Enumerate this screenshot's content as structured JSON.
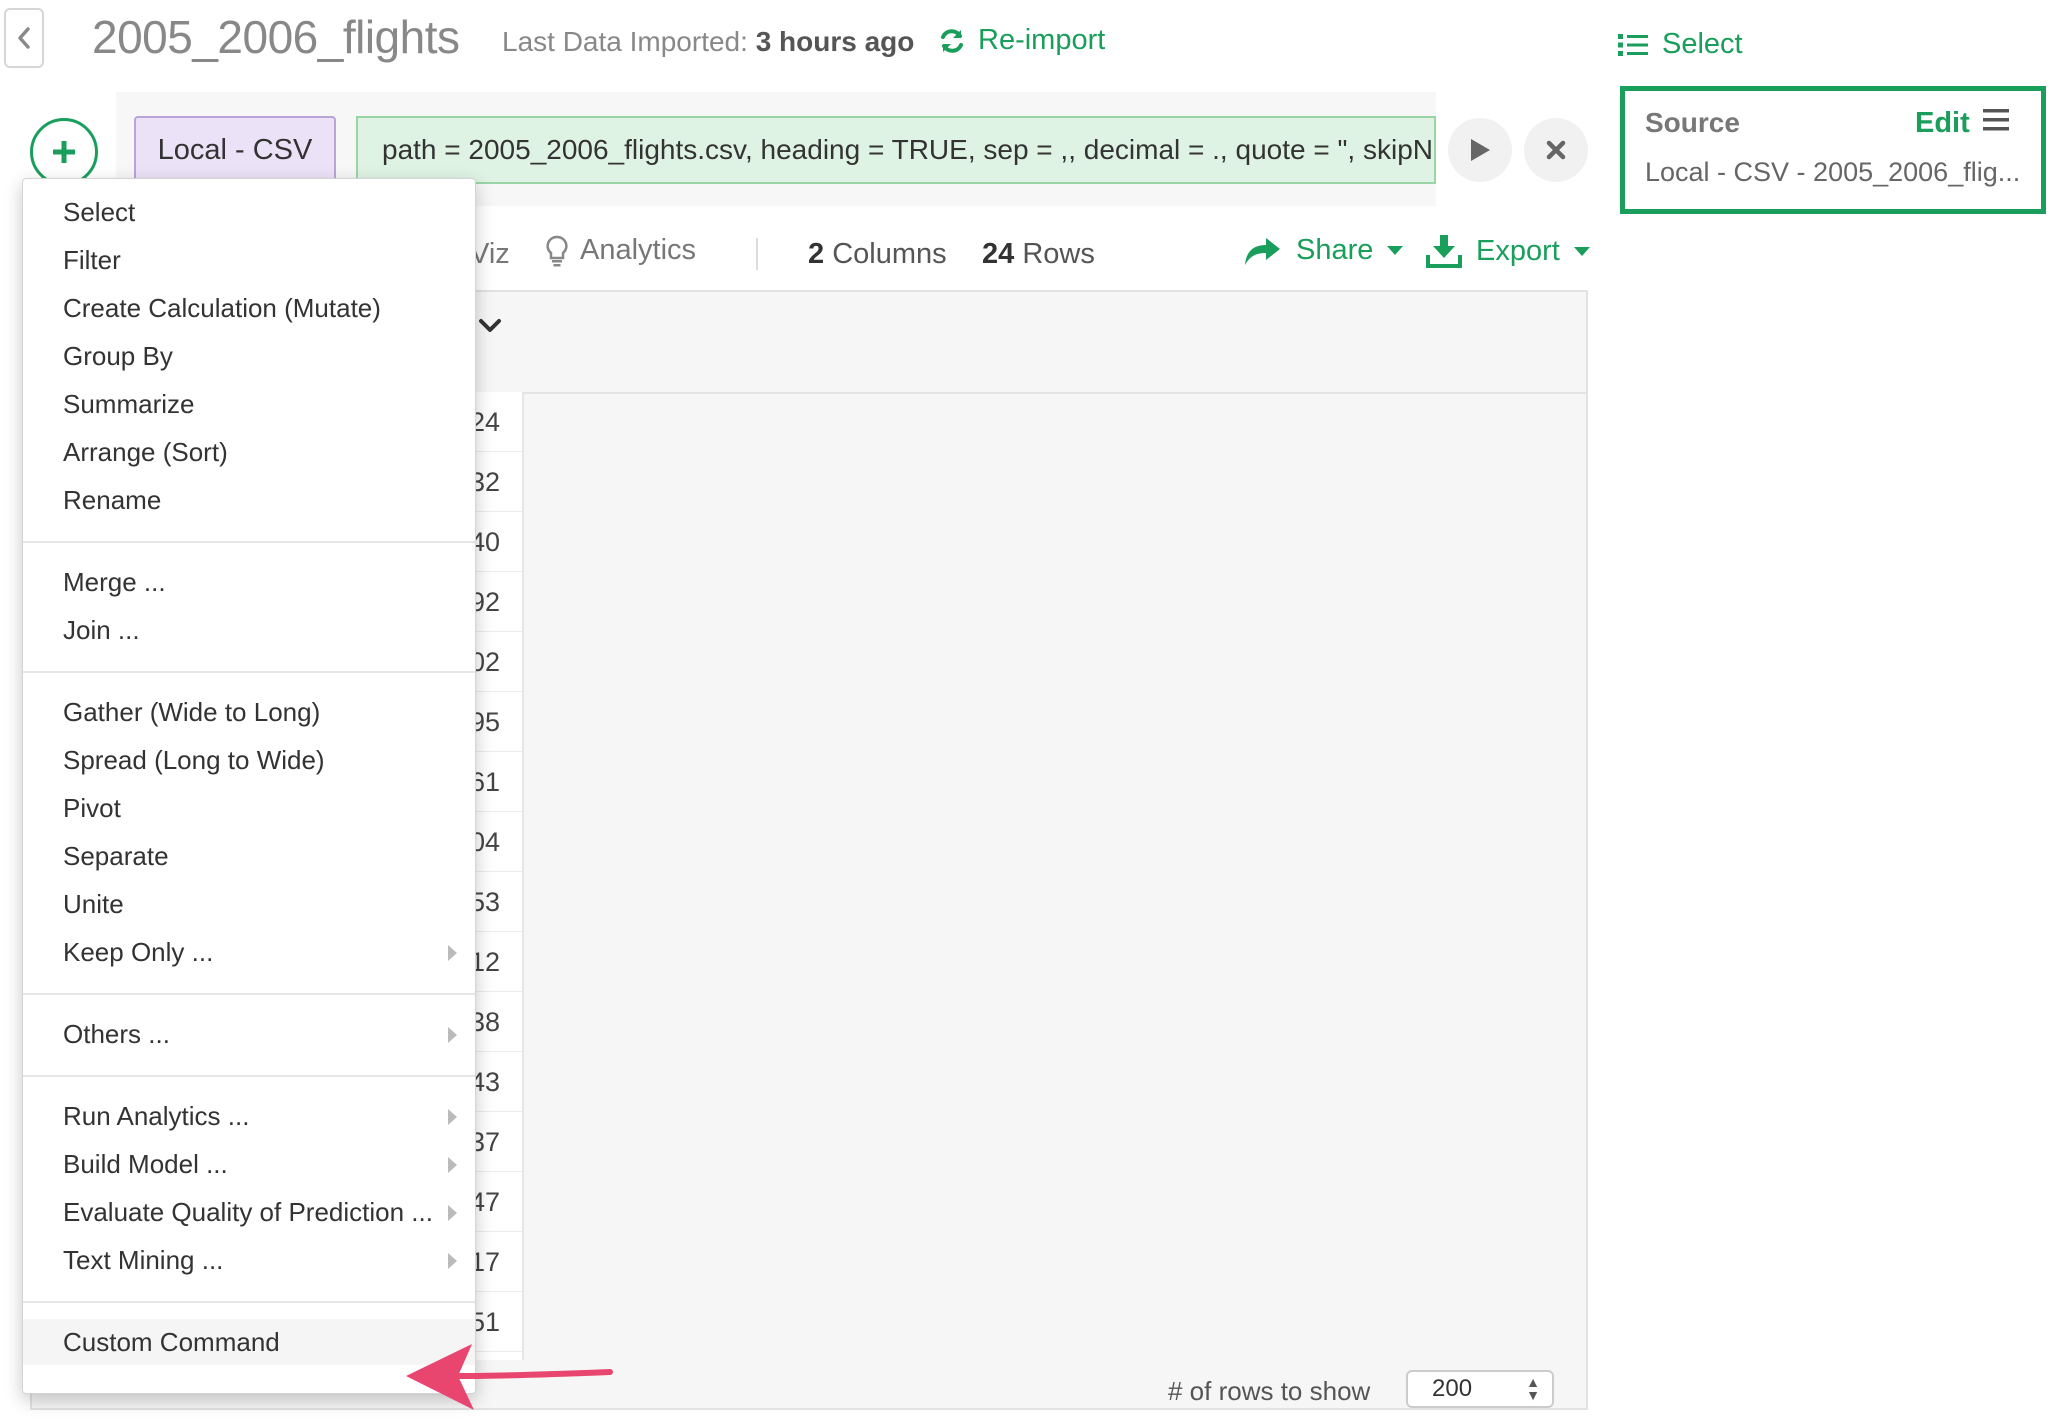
{
  "header": {
    "title": "2005_2006_flights",
    "imported_label": "Last Data Imported:",
    "imported_value": "3 hours ago",
    "reimport_label": "Re-import"
  },
  "right_panel": {
    "select_label": "Select",
    "source_label": "Source",
    "edit_label": "Edit",
    "source_desc": "Local - CSV - 2005_2006_flig..."
  },
  "command": {
    "step_label": "Local - CSV",
    "text": "path = 2005_2006_flights.csv, heading = TRUE, sep = ,, decimal = ., quote = \", skipN"
  },
  "toolbar": {
    "viz_label": "Viz",
    "analytics_label": "Analytics",
    "columns_count": "2",
    "columns_label": "Columns",
    "rows_count": "24",
    "rows_label": "Rows",
    "share_label": "Share",
    "export_label": "Export"
  },
  "grid": {
    "row_fragments": [
      "24",
      "32",
      "40",
      "92",
      "02",
      "95",
      "61",
      "04",
      "53",
      "12",
      "38",
      "43",
      "37",
      "47",
      "17",
      "51"
    ],
    "rows_to_show_label": "# of rows to show",
    "rows_to_show_value": "200"
  },
  "menu": {
    "groups": [
      [
        {
          "label": "Select",
          "submenu": false
        },
        {
          "label": "Filter",
          "submenu": false
        },
        {
          "label": "Create Calculation (Mutate)",
          "submenu": false
        },
        {
          "label": "Group By",
          "submenu": false
        },
        {
          "label": "Summarize",
          "submenu": false
        },
        {
          "label": "Arrange (Sort)",
          "submenu": false
        },
        {
          "label": "Rename",
          "submenu": false
        }
      ],
      [
        {
          "label": "Merge ...",
          "submenu": false
        },
        {
          "label": "Join ...",
          "submenu": false
        }
      ],
      [
        {
          "label": "Gather (Wide to Long)",
          "submenu": false
        },
        {
          "label": "Spread (Long to Wide)",
          "submenu": false
        },
        {
          "label": "Pivot",
          "submenu": false
        },
        {
          "label": "Separate",
          "submenu": false
        },
        {
          "label": "Unite",
          "submenu": false
        },
        {
          "label": "Keep Only ...",
          "submenu": true
        }
      ],
      [
        {
          "label": "Others ...",
          "submenu": true
        }
      ],
      [
        {
          "label": "Run Analytics ...",
          "submenu": true
        },
        {
          "label": "Build Model ...",
          "submenu": true
        },
        {
          "label": "Evaluate Quality of Prediction ...",
          "submenu": true
        },
        {
          "label": "Text Mining ...",
          "submenu": true
        }
      ],
      [
        {
          "label": "Custom Command",
          "submenu": false,
          "highlighted": true
        }
      ]
    ]
  },
  "colors": {
    "accent": "#1a9e5c",
    "step_bg": "#ece2f7",
    "command_bg": "#dff3e4",
    "annotation_arrow": "#e8466f"
  }
}
